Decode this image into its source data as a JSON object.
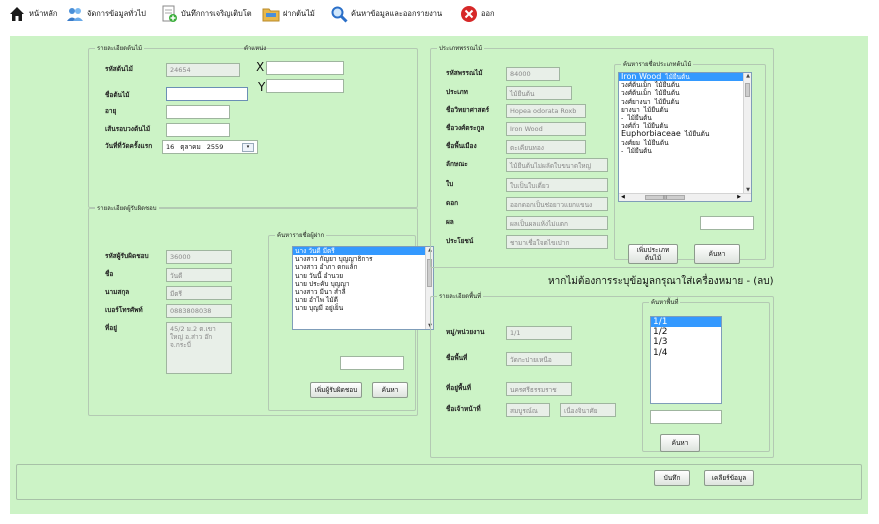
{
  "toolbar": {
    "home": "หน้าหลัก",
    "general": "จัดการข้อมูลทั่วไป",
    "growth": "บันทึกการเจริญเติบโต",
    "deposit": "ฝากต้นไม้",
    "search": "ค้นหาข้อมูลและออกรายงาน",
    "exit": "ออก"
  },
  "tree_detail": {
    "title": "รายละเอียดต้นไม้",
    "position_title": "ตำแหน่ง",
    "code_label": "รหัสต้นไม้",
    "code_value": "24654",
    "name_label": "ชื่อต้นไม้",
    "age_label": "อายุ",
    "girth_label": "เส้นรอบวงต้นไม้",
    "date_label": "วันที่ที่วัดครั้งแรก",
    "date_day": "16",
    "date_month": "ตุลาคม",
    "date_year": "2559",
    "x_label": "X",
    "y_label": "Y"
  },
  "responsible": {
    "title": "รายละเอียดผู้รับผิดชอบ",
    "code_label": "รหัสผู้รับผิดชอบ",
    "code_value": "36000",
    "name_label": "ชื่อ",
    "name_value": "วันดี",
    "surname_label": "นามสกุล",
    "surname_value": "มีตรี",
    "phone_label": "เบอร์โทรศัพท์",
    "phone_value": "0883808038",
    "address_label": "ที่อยู่",
    "address_value": "45/2 ม.2 ต.เขาใหญ่ อ.ส่าว อ๊ก จ.กระบี่"
  },
  "resp_search": {
    "title": "ค้นหารายชื่อผู้ฝาก",
    "items": [
      "นาง วันดี มีตรี",
      "นางสาว กัญยา บุญญาธิการ",
      "นางสาว อำภา ตกแล้ก",
      "นาย วันนี้ อำนวย",
      "นาย ประคับ บุญญา",
      "นางสาว มีนา สำลี",
      "นาย อำไพ ไม้ดี",
      "นาย บุญมี อยู่เย็น"
    ],
    "add_button": "เพิ่มผู้รับผิดชอบ",
    "search_button": "ค้นหา"
  },
  "species": {
    "title": "ประเภทพรรณไม้",
    "code_label": "รหัสพรรณไม้",
    "code_value": "84000",
    "type_label": "ประเภท",
    "type_value": "ไม้ยืนต้น",
    "sci_label": "ชื่อวิทยาศาสตร์",
    "sci_value": "Hopea odorata Roxb",
    "family_label": "ชื่อวงศ์ตระกูล",
    "family_value": "Iron Wood",
    "local_label": "ชื่อพื้นเมือง",
    "local_value": "ตะเคียนทอง",
    "feature_label": "ลักษณะ",
    "feature_value": "ไม้ยืนต้นไม่ผลัดใบขนาดใหญ่",
    "leaf_label": "ใบ",
    "leaf_value": "ใบเป็นใบเดี่ยว",
    "flower_label": "ดอก",
    "flower_value": "ออกดอกเป็นช่อยาวแยกแขนง",
    "fruit_label": "ผล",
    "fruit_value": "ผลเป็นผลแห้งไม่แตก",
    "benefit_label": "ประโยชน์",
    "benefit_value": "ชามาเชื่อใจตไขเปาก"
  },
  "species_search": {
    "title": "ค้นหารายชื่อประเภทต้นไม้",
    "items": [
      {
        "name": "Iron Wood",
        "type": "ไม้ยืนต้น"
      },
      {
        "name": "วงศ์ต้นเม็ก",
        "type": "ไม้ยืนต้น"
      },
      {
        "name": "วงศ์ต้นเม็ก",
        "type": "ไม้ยืนต้น"
      },
      {
        "name": "วงศ์ยางนา",
        "type": "ไม้ยืนต้น"
      },
      {
        "name": "ยางนา",
        "type": "ไม้ยืนต้น"
      },
      {
        "name": "-",
        "type": "ไม้ยืนต้น"
      },
      {
        "name": "วงศ์ถั่ว",
        "type": "ไม้ยืนต้น"
      },
      {
        "name": "Euphorbiaceae",
        "type": "ไม้ยืนต้น"
      },
      {
        "name": "วงศ์ยม",
        "type": "ไม้ยืนต้น"
      },
      {
        "name": "-",
        "type": "ไม้ยืนต้น"
      }
    ],
    "scroll_label": "III",
    "add_button": "เพิ่มประเภทต้นไม้",
    "search_button": "ค้นหา"
  },
  "notice": "หากไม่ต้องการระบุข้อมูลกรุณาใส่เครื่องหมาย - (ลบ)",
  "area": {
    "title": "รายละเอียดพื้นที่",
    "unit_label": "หมู่/หน่วยงาน",
    "unit_value": "1/1",
    "name_label": "ชื่อพื้นที่",
    "name_value": "วัดกะปายเหนือ",
    "location_label": "ที่อยู่พื้นที่",
    "location_value": "นครศรีธรรมราช",
    "owner_label": "ชื่อเจ้าหน้าที่",
    "owner_first": "สมบูรณ์ณ",
    "owner_last": "เนื่องจินาศัย"
  },
  "area_search": {
    "title": "ค้นหาพื้นที่",
    "items": [
      "1/1",
      "1/2",
      "1/3",
      "1/4"
    ],
    "search_button": "ค้นหา"
  },
  "footer": {
    "save_button": "บันทึก",
    "clear_button": "เคลียร์ข้อมูล"
  },
  "colors": {
    "panel_bg": "#ccf3c6",
    "selection": "#3399ff"
  }
}
